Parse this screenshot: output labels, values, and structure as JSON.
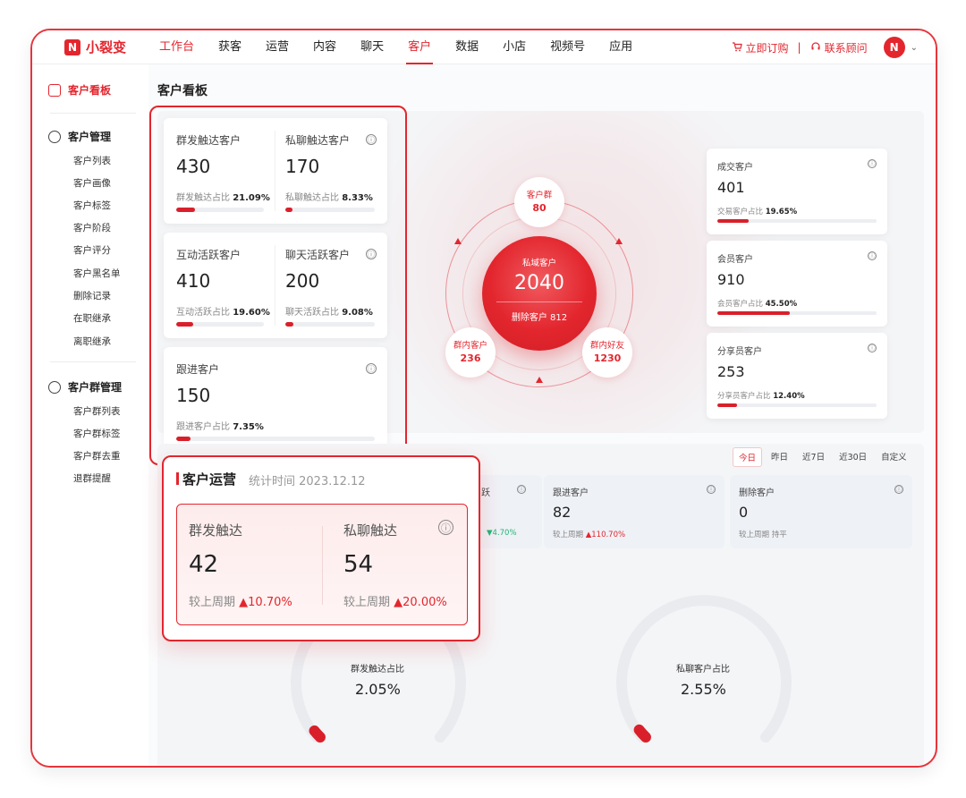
{
  "logo": {
    "mark": "N",
    "name": "小裂变"
  },
  "nav": [
    "工作台",
    "获客",
    "运营",
    "内容",
    "聊天",
    "客户",
    "数据",
    "小店",
    "视频号",
    "应用"
  ],
  "top_right": {
    "order": "立即订购",
    "sep": "|",
    "consult": "联系顾问",
    "avatar": "N",
    "chevron": "⌄"
  },
  "sidebar": {
    "board": "客户看板",
    "mgmt_title": "客户管理",
    "mgmt_items": [
      "客户列表",
      "客户画像",
      "客户标签",
      "客户阶段",
      "客户评分",
      "客户黑名单",
      "删除记录",
      "在职继承",
      "离职继承"
    ],
    "group_title": "客户群管理",
    "group_items": [
      "客户群列表",
      "客户群标签",
      "客户群去重",
      "退群提醒"
    ]
  },
  "page_title": "客户看板",
  "left_cards": [
    {
      "label": "群发触达客户",
      "value": "430",
      "ratio_label": "群发触达占比",
      "ratio": "21.09%",
      "fill": 0.2109
    },
    {
      "label": "私聊触达客户",
      "value": "170",
      "ratio_label": "私聊触达占比",
      "ratio": "8.33%",
      "fill": 0.0833
    },
    {
      "label": "互动活跃客户",
      "value": "410",
      "ratio_label": "互动活跃占比",
      "ratio": "19.60%",
      "fill": 0.196
    },
    {
      "label": "聊天活跃客户",
      "value": "200",
      "ratio_label": "聊天活跃占比",
      "ratio": "9.08%",
      "fill": 0.0908
    },
    {
      "label": "跟进客户",
      "value": "150",
      "ratio_label": "跟进客户占比",
      "ratio": "7.35%",
      "fill": 0.0735
    }
  ],
  "center": {
    "main_label": "私域客户",
    "main_value": "2040",
    "deleted": "删除客户 812",
    "group": {
      "label": "客户群",
      "value": "80"
    },
    "in_group": {
      "label": "群内客户",
      "value": "236"
    },
    "friends": {
      "label": "群内好友",
      "value": "1230"
    }
  },
  "right_cards": [
    {
      "label": "成交客户",
      "value": "401",
      "ratio_label": "交易客户占比",
      "ratio": "19.65%",
      "fill": 0.1965
    },
    {
      "label": "会员客户",
      "value": "910",
      "ratio_label": "会员客户占比",
      "ratio": "45.50%",
      "fill": 0.455
    },
    {
      "label": "分享员客户",
      "value": "253",
      "ratio_label": "分享员客户占比",
      "ratio": "12.40%",
      "fill": 0.124
    }
  ],
  "tabs": [
    "今日",
    "昨日",
    "近7日",
    "近30日",
    "自定义"
  ],
  "ops_cards": [
    {
      "label": "跃",
      "value": "",
      "cmp": "▼4.70%"
    },
    {
      "label": "跟进客户",
      "value": "82",
      "cmp_label": "较上周期",
      "cmp": "▲110.70%"
    },
    {
      "label": "删除客户",
      "value": "0",
      "cmp_label": "较上周期",
      "cmp": "持平"
    }
  ],
  "gauges": [
    {
      "label": "群发触达占比",
      "value": "2.05%",
      "fill": 0.0205
    },
    {
      "label": "私聊客户占比",
      "value": "2.55%",
      "fill": 0.0255
    }
  ],
  "popup": {
    "title": "客户运营",
    "time": "统计时间 2023.12.12",
    "items": [
      {
        "label": "群发触达",
        "value": "42",
        "cmp_label": "较上周期",
        "cmp": "▲10.70%"
      },
      {
        "label": "私聊触达",
        "value": "54",
        "cmp_label": "较上周期",
        "cmp": "▲20.00%"
      }
    ]
  },
  "colors": {
    "brand": "#e3262e",
    "up": "#e3262e",
    "down": "#22b573",
    "bg": "#f4f5f7"
  },
  "icons": {
    "info": "ⓘ",
    "cart": "cart-icon",
    "headset": "headset-icon"
  }
}
